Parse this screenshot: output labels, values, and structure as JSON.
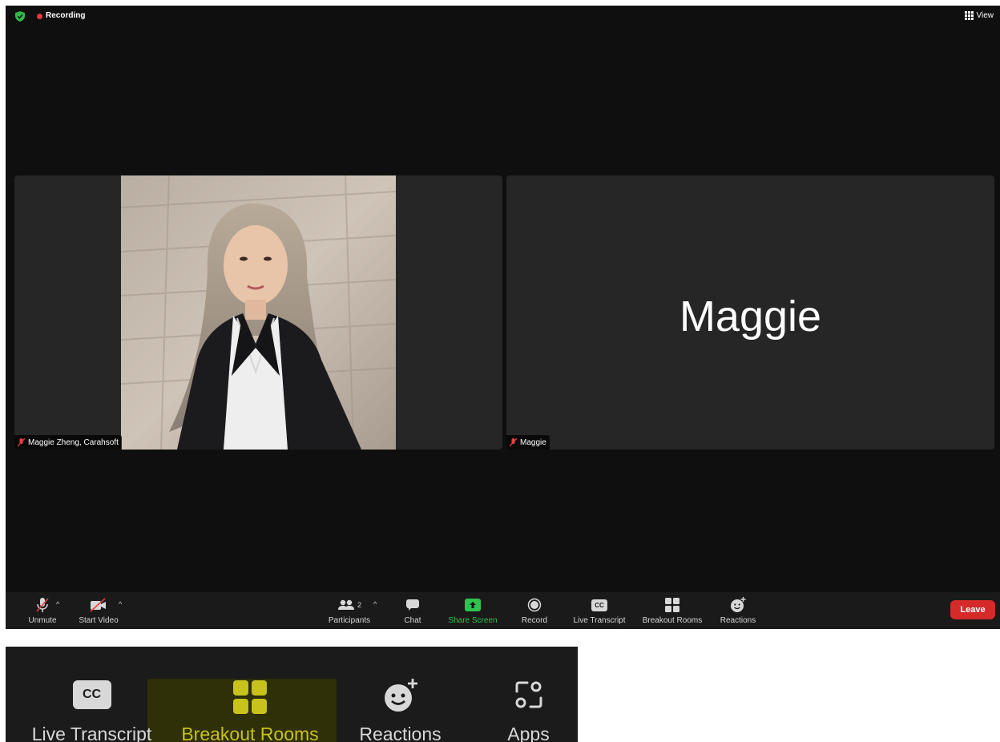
{
  "topbar": {
    "recording_label": "Recording",
    "view_label": "View",
    "shield_icon": "shield-check-icon",
    "colors": {
      "shield": "#2db84c",
      "recording_dot": "#e83a3a"
    }
  },
  "tiles": [
    {
      "name": "Maggie Zheng, Carahsoft",
      "mic": "muted",
      "has_video_image": true
    },
    {
      "name": "Maggie",
      "display_name": "Maggie",
      "mic": "muted",
      "has_video_image": false
    }
  ],
  "toolbar": {
    "unmute_label": "Unmute",
    "start_video_label": "Start Video",
    "participants_label": "Participants",
    "participants_count": "2",
    "chat_label": "Chat",
    "share_screen_label": "Share Screen",
    "record_label": "Record",
    "live_transcript_label": "Live Transcript",
    "cc_text": "CC",
    "breakout_rooms_label": "Breakout Rooms",
    "reactions_label": "Reactions",
    "leave_label": "Leave",
    "colors": {
      "share_screen": "#2ec44d",
      "leave": "#d42a2a"
    }
  },
  "zoomed_crop": {
    "live_transcript_label": "Live Transcript",
    "cc_text": "CC",
    "breakout_rooms_label": "Breakout Rooms",
    "reactions_label": "Reactions",
    "apps_label": "Apps",
    "colors": {
      "highlight_bg": "#2f2f08",
      "breakout_text": "#c8c21c"
    }
  }
}
